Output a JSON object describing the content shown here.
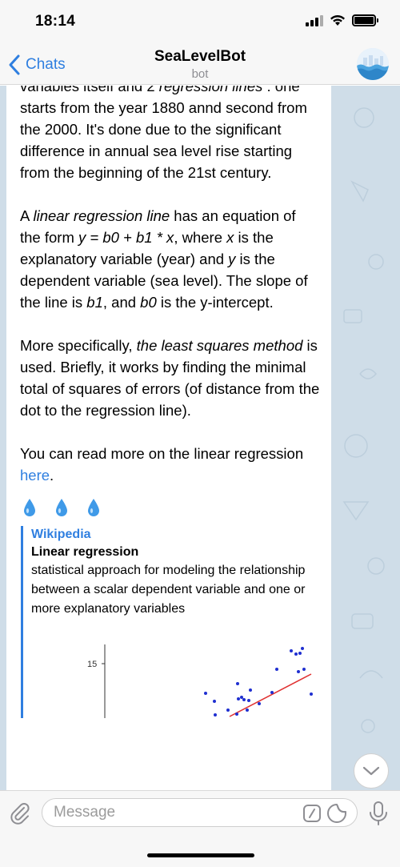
{
  "status": {
    "time": "18:14"
  },
  "nav": {
    "back_label": "Chats",
    "title": "SeaLevelBot",
    "subtitle": "bot"
  },
  "message": {
    "line_cut": "..............................................................",
    "p1": [
      "variables itself and 2 ",
      "regression lines",
      " : one starts from the year 1880 annd second from the 2000. It's done due to the significant difference in annual sea level rise starting from the beginning of the 21st century."
    ],
    "p2": [
      "A ",
      "linear regression line",
      " has an equation of the form ",
      "y = b0 + b1 * x",
      ", where ",
      "x",
      " is the explanatory variable (year) and ",
      "y",
      " is the dependent variable (sea level). The slope of the line is ",
      "b1",
      ", and ",
      "b0",
      " is the y-intercept."
    ],
    "p3": [
      "More specifically, ",
      "the least squares method",
      " is used. Briefly, it works by finding the minimal total of squares of errors (of distance from the dot to the regression line)."
    ],
    "p4": [
      "You can read more on the linear regression ",
      "here",
      "."
    ]
  },
  "preview": {
    "site": "Wikipedia",
    "title": "Linear regression",
    "description": "statistical approach for modeling the relationship between a scalar dependent variable and one or more explanatory variables",
    "chart_tick": "15"
  },
  "input": {
    "placeholder": "Message"
  },
  "colors": {
    "accent": "#2f7fe0",
    "chat_bg": "#cfdde8",
    "bar_bg": "#f7f7f7"
  }
}
